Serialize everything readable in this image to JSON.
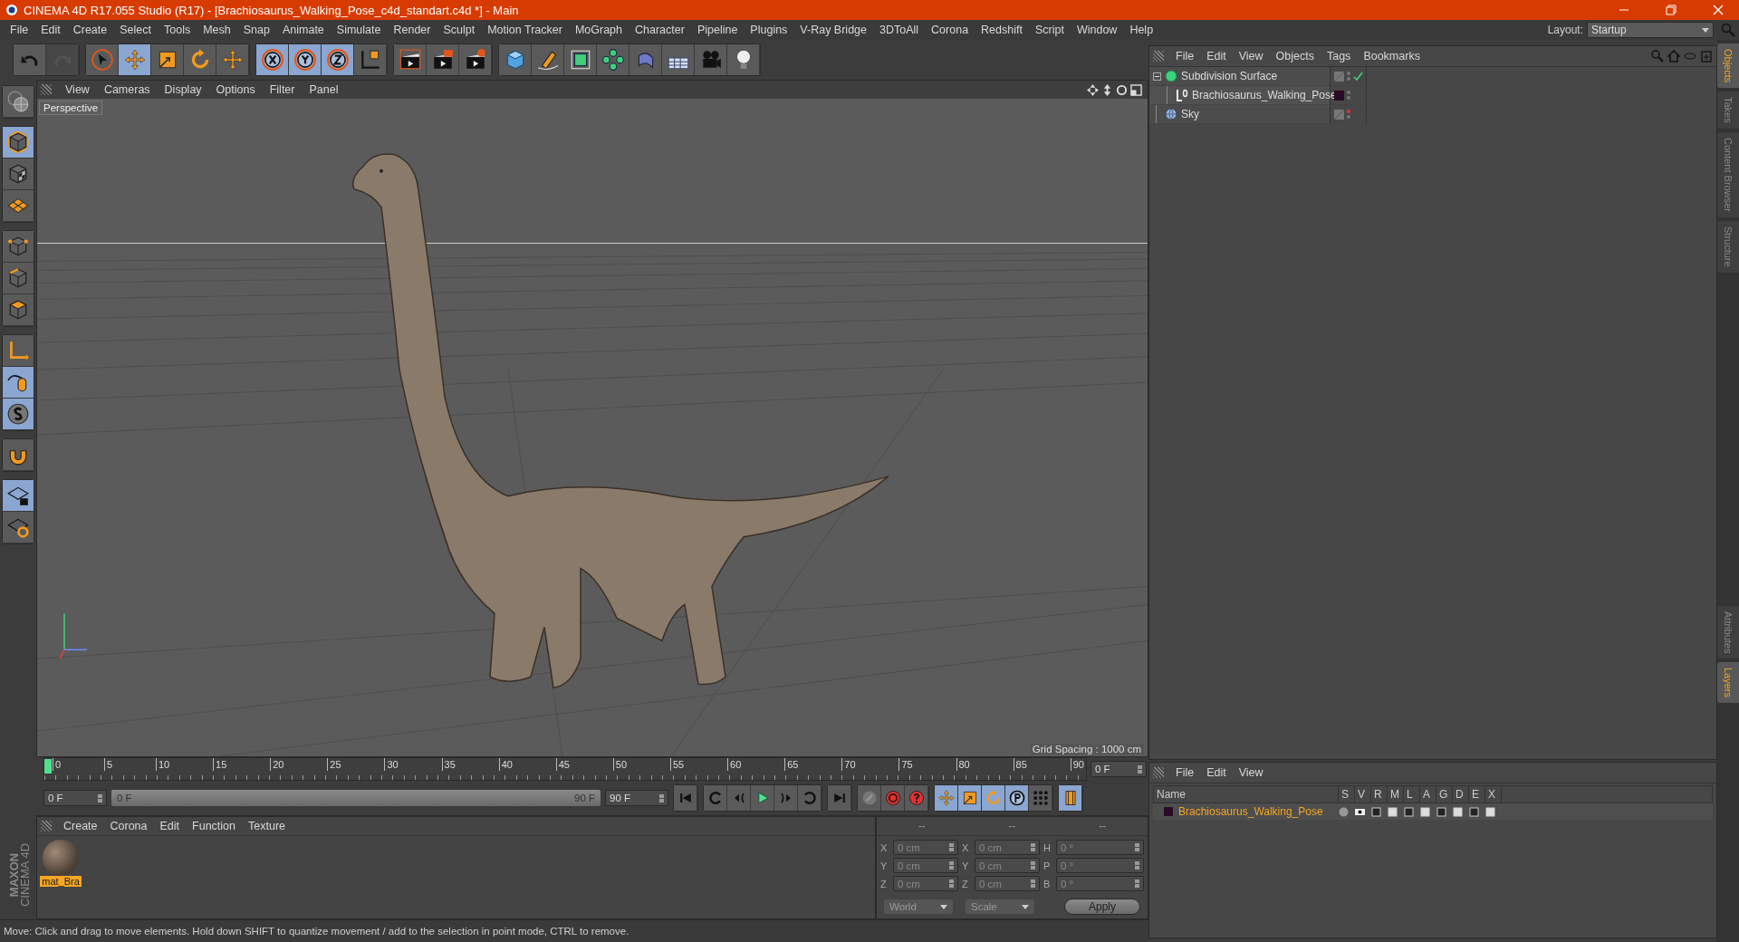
{
  "window": {
    "title": "CINEMA 4D R17.055 Studio (R17) - [Brachiosaurus_Walking_Pose_c4d_standart.c4d *] - Main"
  },
  "menu_bar": [
    "File",
    "Edit",
    "Create",
    "Select",
    "Tools",
    "Mesh",
    "Snap",
    "Animate",
    "Simulate",
    "Render",
    "Sculpt",
    "Motion Tracker",
    "MoGraph",
    "Character",
    "Pipeline",
    "Plugins",
    "V-Ray Bridge",
    "3DToAll",
    "Corona",
    "Redshift",
    "Script",
    "Window",
    "Help"
  ],
  "layout": {
    "label": "Layout:",
    "value": "Startup"
  },
  "toolbar": [
    [
      {
        "kind": "undo",
        "selected": false,
        "disabled": false
      },
      {
        "kind": "redo",
        "selected": false,
        "disabled": true
      }
    ],
    [
      {
        "kind": "select",
        "selected": false,
        "disabled": false
      },
      {
        "kind": "move",
        "selected": true,
        "disabled": false
      },
      {
        "kind": "scale",
        "selected": false,
        "disabled": false
      },
      {
        "kind": "rotate",
        "selected": false,
        "disabled": false
      },
      {
        "kind": "transform",
        "selected": false,
        "disabled": false
      }
    ],
    [
      {
        "kind": "x",
        "selected": true,
        "disabled": false
      },
      {
        "kind": "y",
        "selected": true,
        "disabled": false
      },
      {
        "kind": "z",
        "selected": true,
        "disabled": false
      },
      {
        "kind": "coords",
        "selected": false,
        "disabled": false
      }
    ],
    [
      {
        "kind": "render-view",
        "selected": false,
        "disabled": false
      },
      {
        "kind": "render-picture",
        "selected": false,
        "disabled": false
      },
      {
        "kind": "render-settings",
        "selected": false,
        "disabled": false
      }
    ],
    [
      {
        "kind": "cube",
        "selected": false,
        "disabled": false
      },
      {
        "kind": "pen",
        "selected": false,
        "disabled": false
      },
      {
        "kind": "subdivision",
        "selected": false,
        "disabled": false
      },
      {
        "kind": "cloner",
        "selected": false,
        "disabled": false
      },
      {
        "kind": "bend",
        "selected": false,
        "disabled": false
      },
      {
        "kind": "floor",
        "selected": false,
        "disabled": false
      },
      {
        "kind": "camera",
        "selected": false,
        "disabled": false
      },
      {
        "kind": "light",
        "selected": false,
        "disabled": false
      }
    ]
  ],
  "left_toolbar": [
    [
      {
        "kind": "workplane",
        "selected": false
      }
    ],
    [
      {
        "kind": "model",
        "selected": true
      },
      {
        "kind": "texture",
        "selected": false
      },
      {
        "kind": "grid",
        "selected": false
      }
    ],
    [
      {
        "kind": "points",
        "selected": false
      },
      {
        "kind": "edges",
        "selected": false
      },
      {
        "kind": "polygons",
        "selected": false
      }
    ],
    [
      {
        "kind": "axis",
        "selected": false
      },
      {
        "kind": "tweak",
        "selected": true
      },
      {
        "kind": "snap",
        "selected": true
      }
    ],
    [
      {
        "kind": "magnet",
        "selected": false
      }
    ],
    [
      {
        "kind": "lock",
        "selected": true
      },
      {
        "kind": "sync",
        "selected": false
      }
    ]
  ],
  "brand": [
    "MAXON",
    "CINEMA 4D"
  ],
  "viewport": {
    "menu": [
      "View",
      "Cameras",
      "Display",
      "Options",
      "Filter",
      "Panel"
    ],
    "camera_label": "Perspective",
    "grid_spacing": "Grid Spacing : 1000 cm"
  },
  "timeline": {
    "ticks": [
      "0",
      "5",
      "10",
      "15",
      "20",
      "25",
      "30",
      "35",
      "40",
      "45",
      "50",
      "55",
      "60",
      "65",
      "70",
      "75",
      "80",
      "85",
      "90"
    ],
    "level": 0,
    "current_frame": "0 F",
    "start": "0 F",
    "range": {
      "start": "0 F",
      "end": "90 F",
      "level": 1
    },
    "end": "90 F"
  },
  "playback": [
    [
      {
        "kind": "go-start",
        "selected": false
      }
    ],
    [
      {
        "kind": "prev-key",
        "selected": false
      },
      {
        "kind": "prev-frame",
        "selected": false
      },
      {
        "kind": "play",
        "selected": false
      },
      {
        "kind": "next-frame",
        "selected": false
      },
      {
        "kind": "next-key",
        "selected": false
      }
    ],
    [
      {
        "kind": "go-end",
        "selected": false
      }
    ],
    [
      {
        "kind": "key-off",
        "selected": false
      },
      {
        "kind": "record",
        "selected": false
      },
      {
        "kind": "help",
        "selected": false
      }
    ],
    [
      {
        "kind": "key-move",
        "selected": true
      },
      {
        "kind": "key-scale",
        "selected": true
      },
      {
        "kind": "key-rotate",
        "selected": true
      },
      {
        "kind": "key-param",
        "selected": true
      },
      {
        "kind": "key-points",
        "selected": false
      }
    ],
    [
      {
        "kind": "timeline",
        "selected": true
      }
    ]
  ],
  "material_manager": {
    "menu": [
      "Create",
      "Corona",
      "Edit",
      "Function",
      "Texture"
    ],
    "materials": [
      {
        "name": "mat_Bra",
        "selected": true
      }
    ]
  },
  "coordinates": {
    "headers": [
      "--",
      "--",
      "--"
    ],
    "rows": [
      {
        "pos_label": "X",
        "pos_value": "0 cm",
        "size_label": "X",
        "size_value": "0 cm",
        "rot_label": "H",
        "rot_value": "0 °"
      },
      {
        "pos_label": "Y",
        "pos_value": "0 cm",
        "size_label": "Y",
        "size_value": "0 cm",
        "rot_label": "P",
        "rot_value": "0 °"
      },
      {
        "pos_label": "Z",
        "pos_value": "0 cm",
        "size_label": "Z",
        "size_value": "0 cm",
        "rot_label": "B",
        "rot_value": "0 °"
      }
    ],
    "dropdowns": [
      "World",
      "Scale"
    ],
    "apply": "Apply"
  },
  "status_bar": "Move: Click and drag to move elements. Hold down SHIFT to quantize movement / add to the selection in point mode, CTRL to remove.",
  "object_manager": {
    "menu": [
      "File",
      "Edit",
      "View",
      "Objects",
      "Tags",
      "Bookmarks"
    ],
    "objects": [
      {
        "name": "Subdivision Surface",
        "kind": "subdivision",
        "expanded": true,
        "enabled": true,
        "editor_hidden": false,
        "children": [
          {
            "name": "Brachiosaurus_Walking_Pose",
            "kind": "null",
            "expanded": false,
            "enabled": false,
            "editor_hidden": false
          }
        ]
      },
      {
        "name": "Sky",
        "kind": "sky",
        "expanded": false,
        "enabled": false,
        "editor_hidden": true
      }
    ]
  },
  "layer_manager": {
    "menu": [
      "File",
      "Edit",
      "View"
    ],
    "columns": [
      "Name",
      "S",
      "V",
      "R",
      "M",
      "L",
      "A",
      "G",
      "D",
      "E",
      "X"
    ],
    "layers": [
      {
        "name": "Brachiosaurus_Walking_Pose",
        "color": "#2a0a24"
      }
    ]
  },
  "side_tabs_top": [
    {
      "label": "Objects",
      "selected": true
    },
    {
      "label": "Takes",
      "selected": false
    },
    {
      "label": "Content Browser",
      "selected": false
    },
    {
      "label": "Structure",
      "selected": false
    }
  ],
  "side_tabs_bottom": [
    {
      "label": "Attributes",
      "selected": false
    },
    {
      "label": "Layers",
      "selected": true
    }
  ]
}
